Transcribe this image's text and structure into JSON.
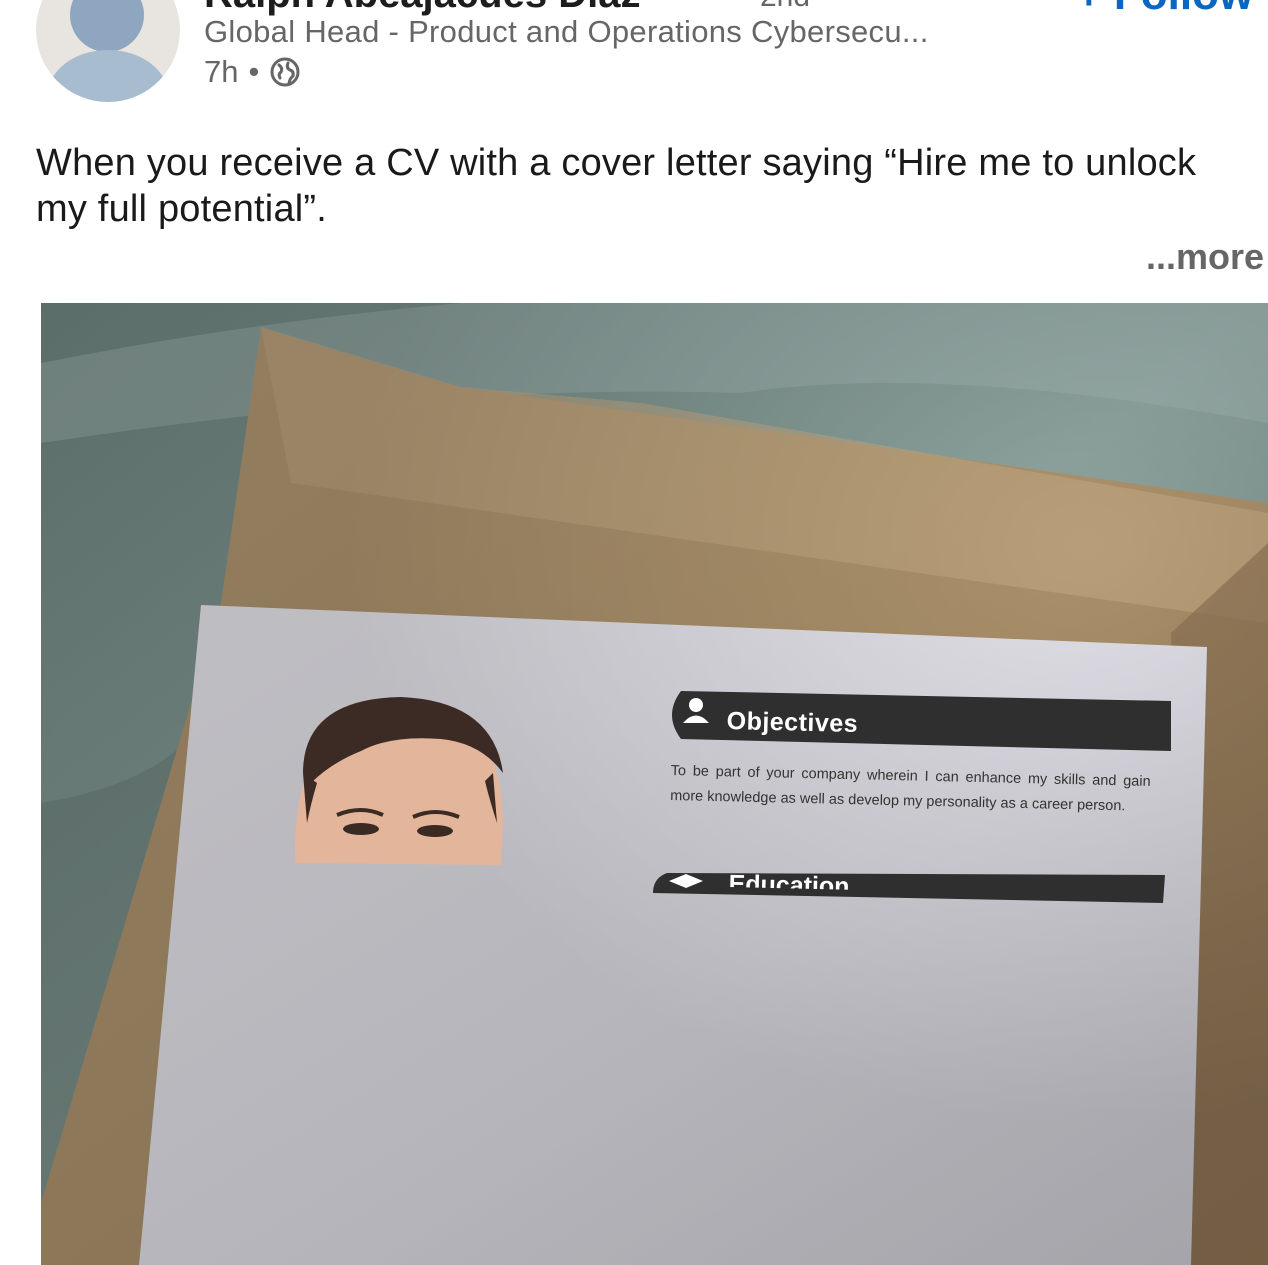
{
  "author": {
    "name": "Ralph Abeajacues Diaz",
    "degree": "2nd",
    "headline": "Global Head - Product and Operations Cybersecu...",
    "time": "7h",
    "visibility_icon": "globe-icon",
    "follow_label": "+ Follow"
  },
  "post": {
    "text": "When you receive a CV with a cover letter saying “Hire me to unlock my full potential”.",
    "more_label": "...more"
  },
  "image": {
    "cv_objectives_heading": "Objectives",
    "cv_objectives_text": "To be part of your company wherein I can enhance my skills and gain more knowledge as well as develop my personality as a career person.",
    "cv_education_heading": "Education"
  },
  "colors": {
    "accent": "#0a66c2",
    "secondary_text": "#666666"
  }
}
